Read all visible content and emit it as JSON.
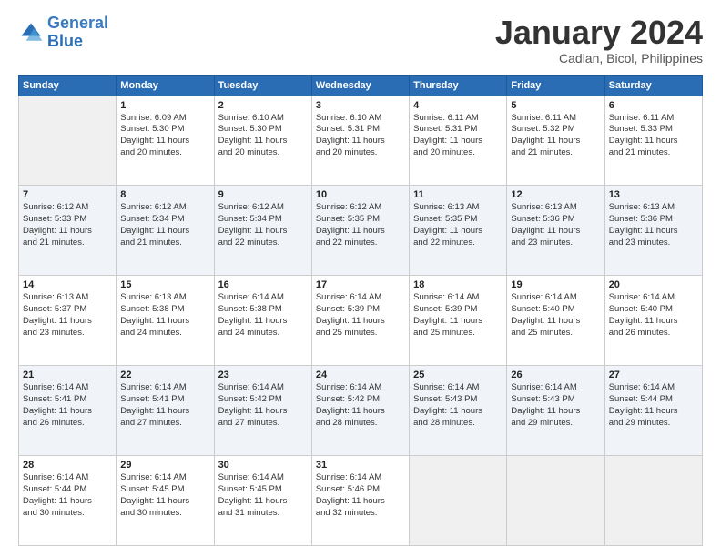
{
  "logo": {
    "line1": "General",
    "line2": "Blue"
  },
  "title": "January 2024",
  "subtitle": "Cadlan, Bicol, Philippines",
  "days_of_week": [
    "Sunday",
    "Monday",
    "Tuesday",
    "Wednesday",
    "Thursday",
    "Friday",
    "Saturday"
  ],
  "weeks": [
    [
      {
        "num": "",
        "info": ""
      },
      {
        "num": "1",
        "info": "Sunrise: 6:09 AM\nSunset: 5:30 PM\nDaylight: 11 hours\nand 20 minutes."
      },
      {
        "num": "2",
        "info": "Sunrise: 6:10 AM\nSunset: 5:30 PM\nDaylight: 11 hours\nand 20 minutes."
      },
      {
        "num": "3",
        "info": "Sunrise: 6:10 AM\nSunset: 5:31 PM\nDaylight: 11 hours\nand 20 minutes."
      },
      {
        "num": "4",
        "info": "Sunrise: 6:11 AM\nSunset: 5:31 PM\nDaylight: 11 hours\nand 20 minutes."
      },
      {
        "num": "5",
        "info": "Sunrise: 6:11 AM\nSunset: 5:32 PM\nDaylight: 11 hours\nand 21 minutes."
      },
      {
        "num": "6",
        "info": "Sunrise: 6:11 AM\nSunset: 5:33 PM\nDaylight: 11 hours\nand 21 minutes."
      }
    ],
    [
      {
        "num": "7",
        "info": "Sunrise: 6:12 AM\nSunset: 5:33 PM\nDaylight: 11 hours\nand 21 minutes."
      },
      {
        "num": "8",
        "info": "Sunrise: 6:12 AM\nSunset: 5:34 PM\nDaylight: 11 hours\nand 21 minutes."
      },
      {
        "num": "9",
        "info": "Sunrise: 6:12 AM\nSunset: 5:34 PM\nDaylight: 11 hours\nand 22 minutes."
      },
      {
        "num": "10",
        "info": "Sunrise: 6:12 AM\nSunset: 5:35 PM\nDaylight: 11 hours\nand 22 minutes."
      },
      {
        "num": "11",
        "info": "Sunrise: 6:13 AM\nSunset: 5:35 PM\nDaylight: 11 hours\nand 22 minutes."
      },
      {
        "num": "12",
        "info": "Sunrise: 6:13 AM\nSunset: 5:36 PM\nDaylight: 11 hours\nand 23 minutes."
      },
      {
        "num": "13",
        "info": "Sunrise: 6:13 AM\nSunset: 5:36 PM\nDaylight: 11 hours\nand 23 minutes."
      }
    ],
    [
      {
        "num": "14",
        "info": "Sunrise: 6:13 AM\nSunset: 5:37 PM\nDaylight: 11 hours\nand 23 minutes."
      },
      {
        "num": "15",
        "info": "Sunrise: 6:13 AM\nSunset: 5:38 PM\nDaylight: 11 hours\nand 24 minutes."
      },
      {
        "num": "16",
        "info": "Sunrise: 6:14 AM\nSunset: 5:38 PM\nDaylight: 11 hours\nand 24 minutes."
      },
      {
        "num": "17",
        "info": "Sunrise: 6:14 AM\nSunset: 5:39 PM\nDaylight: 11 hours\nand 25 minutes."
      },
      {
        "num": "18",
        "info": "Sunrise: 6:14 AM\nSunset: 5:39 PM\nDaylight: 11 hours\nand 25 minutes."
      },
      {
        "num": "19",
        "info": "Sunrise: 6:14 AM\nSunset: 5:40 PM\nDaylight: 11 hours\nand 25 minutes."
      },
      {
        "num": "20",
        "info": "Sunrise: 6:14 AM\nSunset: 5:40 PM\nDaylight: 11 hours\nand 26 minutes."
      }
    ],
    [
      {
        "num": "21",
        "info": "Sunrise: 6:14 AM\nSunset: 5:41 PM\nDaylight: 11 hours\nand 26 minutes."
      },
      {
        "num": "22",
        "info": "Sunrise: 6:14 AM\nSunset: 5:41 PM\nDaylight: 11 hours\nand 27 minutes."
      },
      {
        "num": "23",
        "info": "Sunrise: 6:14 AM\nSunset: 5:42 PM\nDaylight: 11 hours\nand 27 minutes."
      },
      {
        "num": "24",
        "info": "Sunrise: 6:14 AM\nSunset: 5:42 PM\nDaylight: 11 hours\nand 28 minutes."
      },
      {
        "num": "25",
        "info": "Sunrise: 6:14 AM\nSunset: 5:43 PM\nDaylight: 11 hours\nand 28 minutes."
      },
      {
        "num": "26",
        "info": "Sunrise: 6:14 AM\nSunset: 5:43 PM\nDaylight: 11 hours\nand 29 minutes."
      },
      {
        "num": "27",
        "info": "Sunrise: 6:14 AM\nSunset: 5:44 PM\nDaylight: 11 hours\nand 29 minutes."
      }
    ],
    [
      {
        "num": "28",
        "info": "Sunrise: 6:14 AM\nSunset: 5:44 PM\nDaylight: 11 hours\nand 30 minutes."
      },
      {
        "num": "29",
        "info": "Sunrise: 6:14 AM\nSunset: 5:45 PM\nDaylight: 11 hours\nand 30 minutes."
      },
      {
        "num": "30",
        "info": "Sunrise: 6:14 AM\nSunset: 5:45 PM\nDaylight: 11 hours\nand 31 minutes."
      },
      {
        "num": "31",
        "info": "Sunrise: 6:14 AM\nSunset: 5:46 PM\nDaylight: 11 hours\nand 32 minutes."
      },
      {
        "num": "",
        "info": ""
      },
      {
        "num": "",
        "info": ""
      },
      {
        "num": "",
        "info": ""
      }
    ]
  ]
}
